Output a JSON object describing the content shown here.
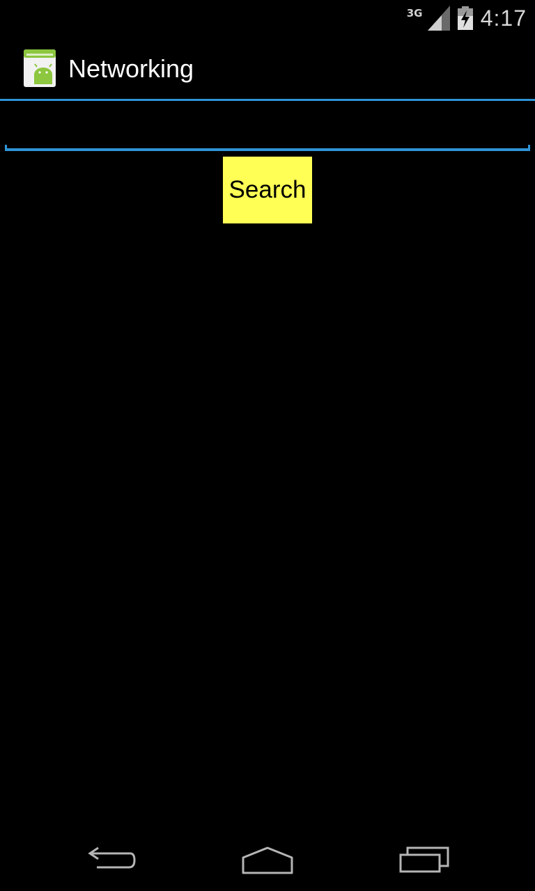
{
  "status_bar": {
    "network_label": "3G",
    "time": "4:17",
    "icons": [
      "signal-icon",
      "battery-icon"
    ]
  },
  "action_bar": {
    "title": "Networking",
    "icon": "android-app-icon"
  },
  "search_input": {
    "value": "",
    "placeholder": ""
  },
  "search_button": {
    "label": "Search",
    "color": "#ffff55"
  },
  "nav_bar": {
    "icons": [
      "back-icon",
      "home-icon",
      "recent-apps-icon"
    ]
  },
  "colors": {
    "accent": "#2f94d6",
    "background": "#000000"
  }
}
